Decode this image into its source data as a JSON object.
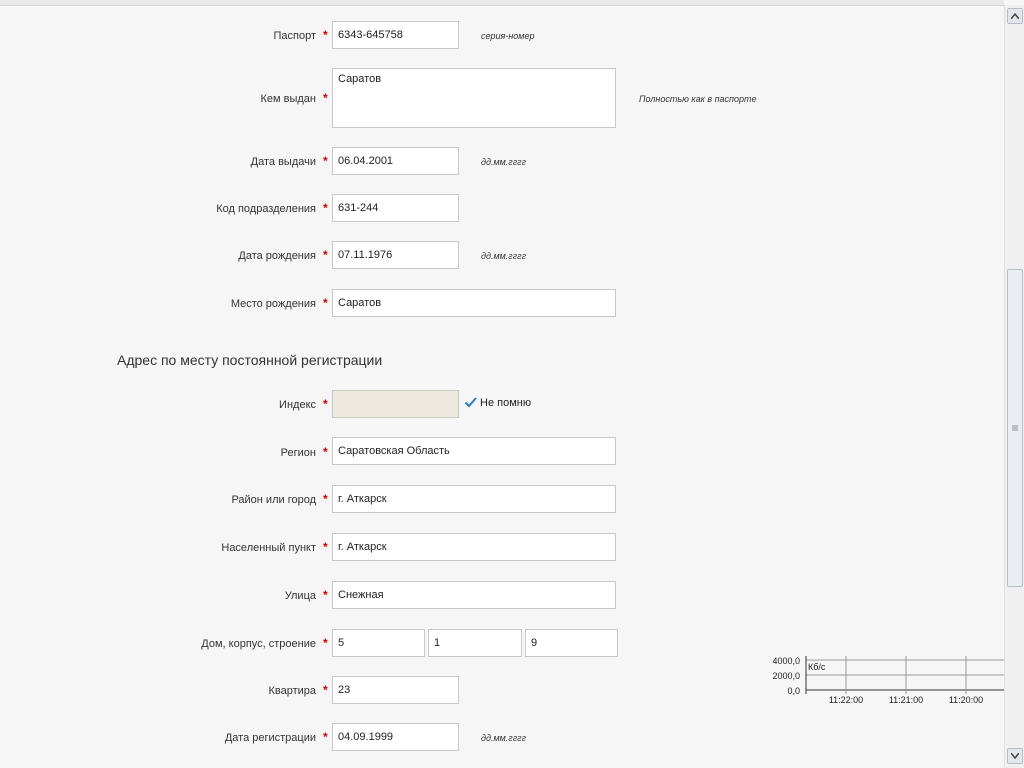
{
  "form": {
    "required_mark": "*",
    "passport": {
      "label": "Паспорт",
      "value": "6343-645758",
      "hint": "серия-номер"
    },
    "issued_by": {
      "label": "Кем выдан",
      "value": "Саратов",
      "hint": "Полностью как в паспорте"
    },
    "issue_date": {
      "label": "Дата выдачи",
      "value": "06.04.2001",
      "hint": "дд.мм.гггг"
    },
    "division_code": {
      "label": "Код подразделения",
      "value": "631-244"
    },
    "birth_date": {
      "label": "Дата рождения",
      "value": "07.11.1976",
      "hint": "дд.мм.гггг"
    },
    "birth_place": {
      "label": "Место рождения",
      "value": "Саратов"
    }
  },
  "address": {
    "section_title": "Адрес по месту постоянной регистрации",
    "index": {
      "label": "Индекс",
      "value": "",
      "dont_remember_label": "Не помню",
      "dont_remember_checked": true
    },
    "region": {
      "label": "Регион",
      "value": "Саратовская Область"
    },
    "district": {
      "label": "Район или город",
      "value": "г. Аткарск"
    },
    "locality": {
      "label": "Населенный пункт",
      "value": "г. Аткарск"
    },
    "street": {
      "label": "Улица",
      "value": "Снежная"
    },
    "house": {
      "label": "Дом, корпус, строение",
      "house_value": "5",
      "building_value": "1",
      "structure_value": "9"
    },
    "apartment": {
      "label": "Квартира",
      "value": "23"
    },
    "registration_date": {
      "label": "Дата регистрации",
      "value": "04.09.1999",
      "hint": "дд.мм.гггг"
    }
  },
  "network_monitor": {
    "unit": "Кб/с",
    "y_ticks": [
      "4000,0",
      "2000,0",
      "0,0"
    ],
    "x_ticks": [
      "11:22:00",
      "11:21:00",
      "11:20:00"
    ]
  },
  "colors": {
    "required": "#cc0000",
    "disabled_input": "#ede9df",
    "checkmark": "#2a7fc1"
  }
}
